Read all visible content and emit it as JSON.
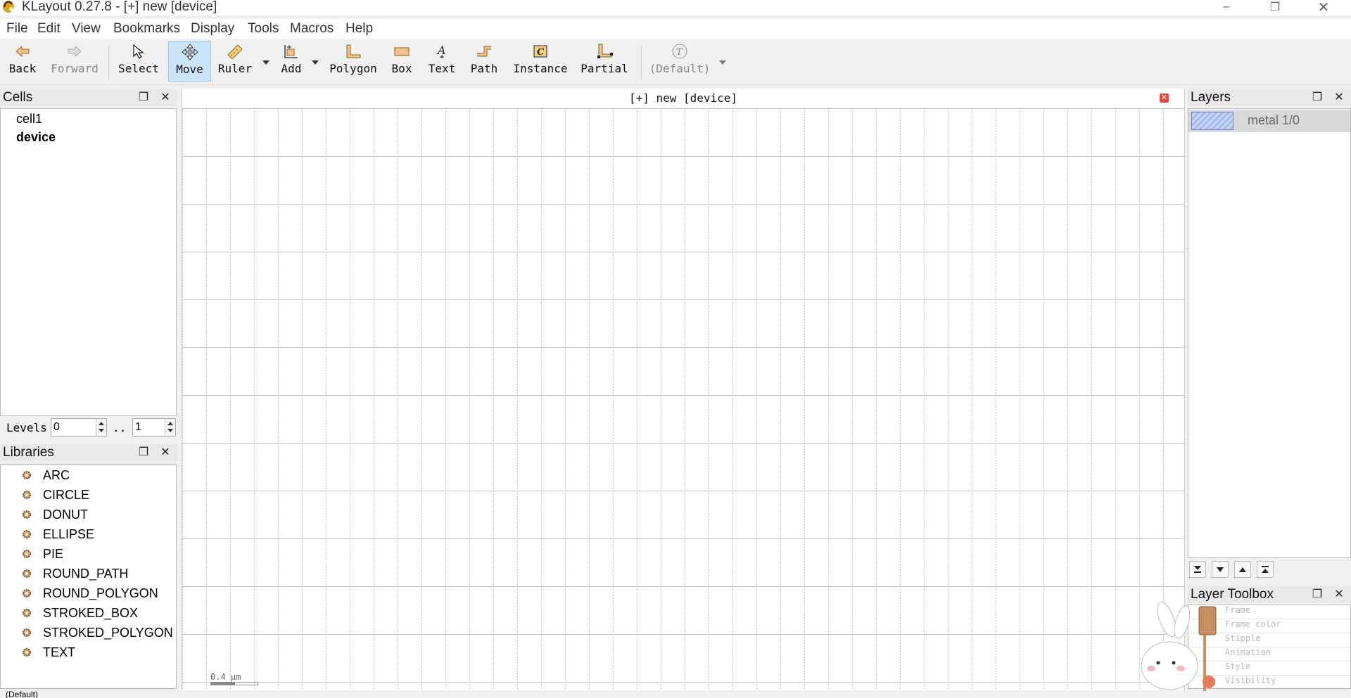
{
  "window": {
    "title": "KLayout 0.27.8 - [+] new [device]"
  },
  "menu": [
    "File",
    "Edit",
    "View",
    "Bookmarks",
    "Display",
    "Tools",
    "Macros",
    "Help"
  ],
  "toolbar": {
    "back": "Back",
    "forward": "Forward",
    "select": "Select",
    "move": "Move",
    "ruler": "Ruler",
    "add": "Add",
    "polygon": "Polygon",
    "box": "Box",
    "text": "Text",
    "path": "Path",
    "instance": "Instance",
    "partial": "Partial",
    "default": "(Default)"
  },
  "cells": {
    "title": "Cells",
    "items": [
      "cell1",
      "device"
    ]
  },
  "levels": {
    "label": "Levels",
    "from": "0",
    "sep": "..",
    "to": "1"
  },
  "libraries": {
    "title": "Libraries",
    "items": [
      "ARC",
      "CIRCLE",
      "DONUT",
      "ELLIPSE",
      "PIE",
      "ROUND_PATH",
      "ROUND_POLYGON",
      "STROKED_BOX",
      "STROKED_POLYGON",
      "TEXT"
    ]
  },
  "canvas": {
    "title": "[+] new [device]",
    "scale": "0.4 µm"
  },
  "layers": {
    "title": "Layers",
    "items": [
      {
        "name": "metal 1/0"
      }
    ]
  },
  "toolbox": {
    "title": "Layer Toolbox",
    "rows": [
      "Frame",
      "Frame color",
      "Stipple",
      "Animation",
      "Style",
      "Visibility"
    ]
  },
  "status": {
    "left": "(Default)"
  },
  "colors": {
    "active_tool_bg": "#cce4f7",
    "layer_fill": "#9fb3ea",
    "close_red": "#e8463e"
  }
}
